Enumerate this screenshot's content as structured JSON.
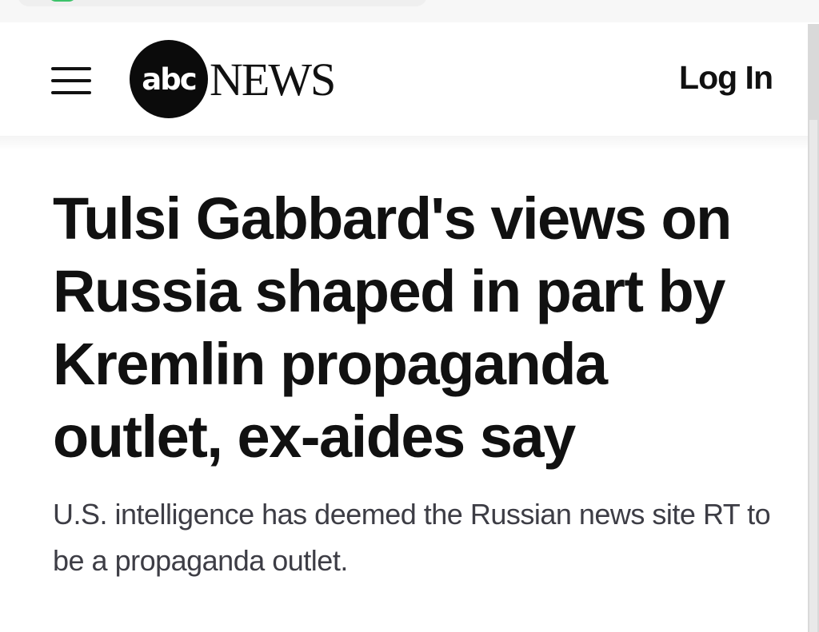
{
  "header": {
    "menu_icon": "hamburger-menu-icon",
    "logo": {
      "badge": "abc",
      "wordmark": "NEWS"
    },
    "login_label": "Log In"
  },
  "article": {
    "headline": "Tulsi Gabbard's views on Russia shaped in part by Kremlin propaganda outlet, ex-aides say",
    "subheadline": "U.S. intelligence has deemed the Russian news site RT to be a propaganda outlet."
  },
  "colors": {
    "text": "#111111",
    "subtext": "#3d3d45",
    "logo_badge": "#0b0b0b",
    "status_green": "#3cc26a"
  }
}
